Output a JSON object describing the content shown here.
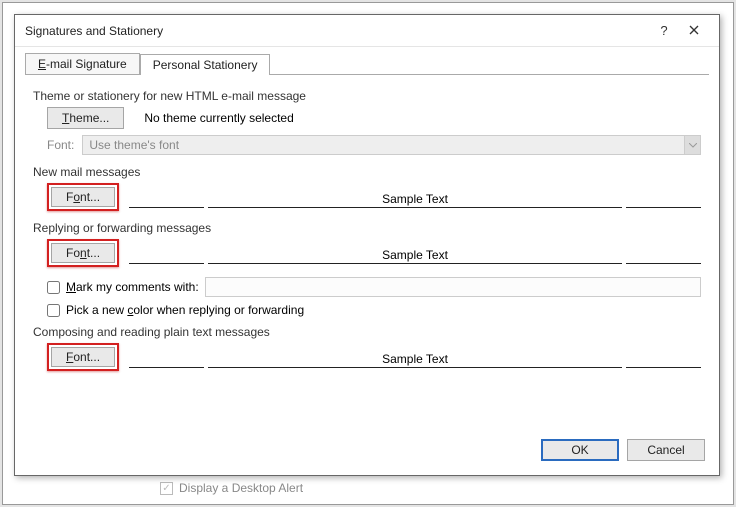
{
  "dialog": {
    "title": "Signatures and Stationery"
  },
  "tabs": {
    "email_signature": "E-mail Signature",
    "personal_stationery": "Personal Stationery",
    "active_index": 1
  },
  "theme_section": {
    "heading": "Theme or stationery for new HTML e-mail message",
    "theme_button": "Theme...",
    "no_theme_text": "No theme currently selected",
    "font_label": "Font:",
    "font_value": "Use theme's font"
  },
  "new_mail": {
    "heading": "New mail messages",
    "font_button": "Font...",
    "sample_text": "Sample Text"
  },
  "reply": {
    "heading": "Replying or forwarding messages",
    "font_button": "Font...",
    "sample_text": "Sample Text",
    "mark_comments_label": "Mark my comments with:",
    "new_color_label": "Pick a new color when replying or forwarding"
  },
  "plain_text": {
    "heading": "Composing and reading plain text messages",
    "font_button": "Font...",
    "sample_text": "Sample Text"
  },
  "footer": {
    "ok": "OK",
    "cancel": "Cancel"
  },
  "background_remnant": "Display a Desktop Alert"
}
